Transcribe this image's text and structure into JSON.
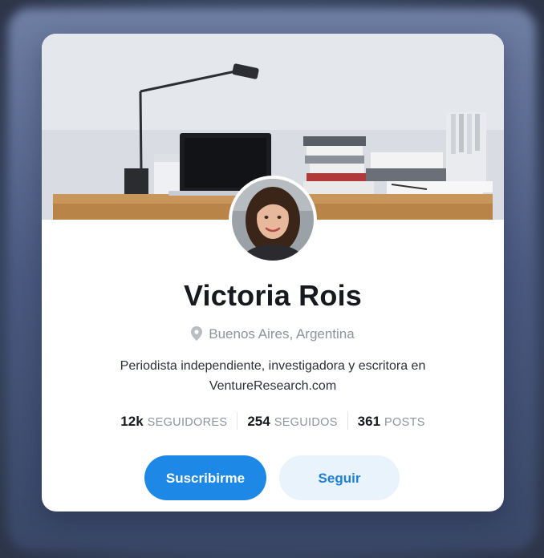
{
  "profile": {
    "name": "Victoria Rois",
    "location": "Buenos Aires, Argentina",
    "bio": "Periodista independiente, investigadora y escritora en VentureResearch.com"
  },
  "stats": [
    {
      "value": "12k",
      "label": "SEGUIDORES"
    },
    {
      "value": "254",
      "label": "SEGUIDOS"
    },
    {
      "value": "361",
      "label": "POSTS"
    }
  ],
  "actions": {
    "subscribe_label": "Suscribirme",
    "follow_label": "Seguir"
  },
  "icons": {
    "location": "location-pin-icon"
  },
  "colors": {
    "primary": "#1d88e5",
    "secondary_bg": "#e9f3fc",
    "secondary_text": "#1d7fd6",
    "muted_text": "#8f939c",
    "title_text": "#17191f"
  }
}
